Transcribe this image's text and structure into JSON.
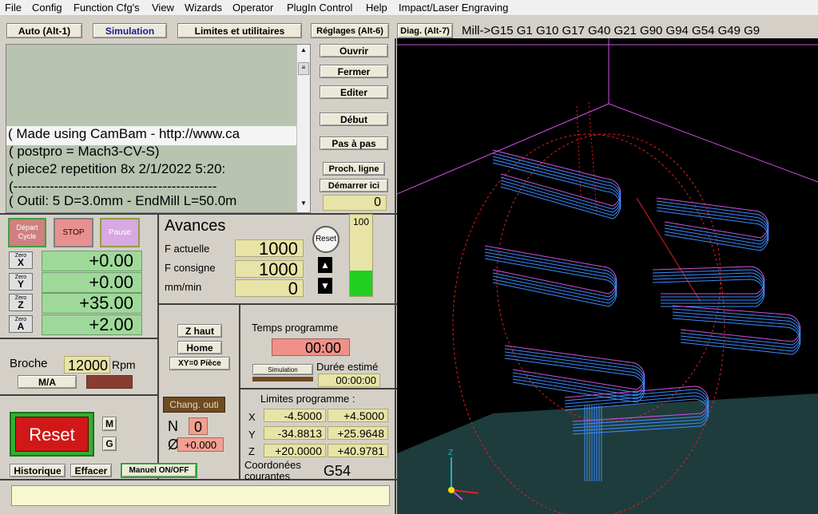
{
  "menu": [
    "File",
    "Config",
    "Function Cfg's",
    "View",
    "Wizards",
    "Operator",
    "PlugIn Control",
    "Help",
    "Impact/Laser Engraving"
  ],
  "tabs": [
    {
      "label": "Auto (Alt-1)",
      "selected": false
    },
    {
      "label": "Simulation",
      "selected": true
    },
    {
      "label": "Limites et utilitaires",
      "selected": false
    },
    {
      "label": "Réglages (Alt-6)",
      "selected": false
    },
    {
      "label": "Diag. (Alt-7)",
      "selected": false
    }
  ],
  "active_gcodes": "Mill->G15  G1 G10 G17 G40 G21 G90 G94 G54 G49  G9",
  "gcode_lines": [
    "( Made using CamBam - http://www.ca",
    "( postpro = Mach3-CV-S)",
    "( piece2  repetition  8x 2/1/2022 5:20:",
    "(---------------------------------------------",
    "( Outil: 5 D=3.0mm - EndMill L=50.0m"
  ],
  "file_buttons": {
    "open": "Ouvrir",
    "close": "Fermer",
    "edit": "Editer",
    "start": "Début",
    "step": "Pas à pas",
    "next_line": "Proch. ligne",
    "run_here": "Démarrer ici",
    "line_number": "0"
  },
  "cycle": {
    "start_line1": "Départ",
    "start_line2": "Cycle",
    "stop": "STOP",
    "pause": "Pause"
  },
  "axes": [
    {
      "name": "X",
      "zero_label": "Zero",
      "value": "+0.00"
    },
    {
      "name": "Y",
      "zero_label": "Zero",
      "value": "+0.00"
    },
    {
      "name": "Z",
      "zero_label": "Zero",
      "value": "+35.00"
    },
    {
      "name": "A",
      "zero_label": "Zero",
      "value": "+2.00"
    }
  ],
  "feed": {
    "title": "Avances",
    "actual_label": "F actuelle",
    "actual_value": "1000",
    "set_label": "F consigne",
    "set_value": "1000",
    "mmmin_label": "mm/min",
    "mmmin_value": "0",
    "reset_label": "Reset",
    "override_percent": "100",
    "override_fill": 0.32
  },
  "spindle": {
    "label": "Broche",
    "rpm_value": "12000",
    "rpm_unit": "Rpm",
    "ma_label": "M/A"
  },
  "reset_button": "Reset",
  "mg_buttons": [
    "M",
    "G"
  ],
  "history_buttons": {
    "history": "Historique",
    "clear": "Effacer",
    "manual": "Manuel ON/OFF"
  },
  "z_buttons": {
    "z_home": "Z haut",
    "home": "Home",
    "xy_zero": "XY=0 Pièce"
  },
  "tool_change": {
    "label": "Chang. outi",
    "n_label": "N",
    "n_value": "0",
    "diameter_symbol": "Ø",
    "diameter_value": "+0.000"
  },
  "time": {
    "program_label": "Temps programme",
    "program_value": "00:00",
    "sim_button": "Simulation",
    "estimated_label": "Durée estimé",
    "estimated_value": "00:00:00"
  },
  "limits": {
    "title": "Limites programme :",
    "rows": [
      {
        "axis": "X",
        "min": "-4.5000",
        "max": "+4.5000"
      },
      {
        "axis": "Y",
        "min": "-34.8813",
        "max": "+25.9648"
      },
      {
        "axis": "Z",
        "min": "+20.0000",
        "max": "+40.9781"
      }
    ]
  },
  "coords": {
    "label_line1": "Coordonées",
    "label_line2": "courantes",
    "value": "G54"
  },
  "status_text": "",
  "colors": {
    "toolpath_blue": "#3a8cff",
    "toolpath_magenta": "#d050e0",
    "stock_red": "#e02020",
    "dro_green": "#9fd99a",
    "axis_cyan": "#20b0c0"
  }
}
